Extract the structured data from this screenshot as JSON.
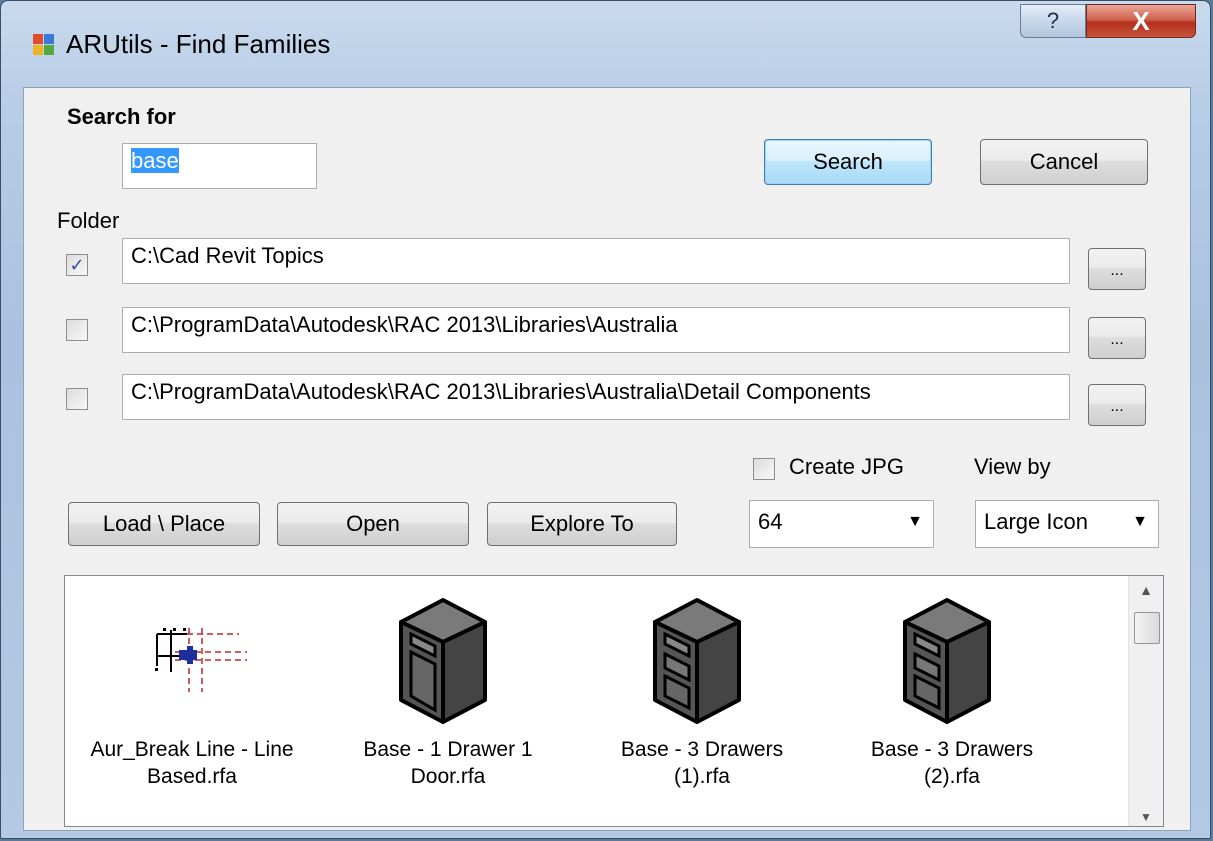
{
  "window": {
    "title": "ARUtils - Find Families",
    "help_glyph": "?",
    "close_glyph": "X"
  },
  "search": {
    "label": "Search for",
    "value": "base",
    "search_button": "Search",
    "cancel_button": "Cancel"
  },
  "folders": {
    "label": "Folder",
    "items": [
      {
        "path": "C:\\Cad Revit Topics",
        "checked": true,
        "browse": "..."
      },
      {
        "path": "C:\\ProgramData\\Autodesk\\RAC 2013\\Libraries\\Australia",
        "checked": false,
        "browse": "..."
      },
      {
        "path": "C:\\ProgramData\\Autodesk\\RAC 2013\\Libraries\\Australia\\Detail Components",
        "checked": false,
        "browse": "..."
      }
    ]
  },
  "options": {
    "create_jpg_label": "Create JPG",
    "create_jpg_checked": false,
    "view_by_label": "View by",
    "size_value": "64",
    "view_by_value": "Large Icon"
  },
  "actions": {
    "load_place": "Load \\ Place",
    "open": "Open",
    "explore_to": "Explore To"
  },
  "results": [
    {
      "line1": "Aur_Break Line - Line",
      "line2": "Based.rfa",
      "icon": "break-line-icon"
    },
    {
      "line1": "Base - 1 Drawer 1",
      "line2": "Door.rfa",
      "icon": "cabinet-1-drawer-door-icon"
    },
    {
      "line1": "Base - 3 Drawers",
      "line2": "(1).rfa",
      "icon": "cabinet-3-drawers-icon"
    },
    {
      "line1": "Base - 3 Drawers",
      "line2": "(2).rfa",
      "icon": "cabinet-3-drawers-icon"
    }
  ]
}
